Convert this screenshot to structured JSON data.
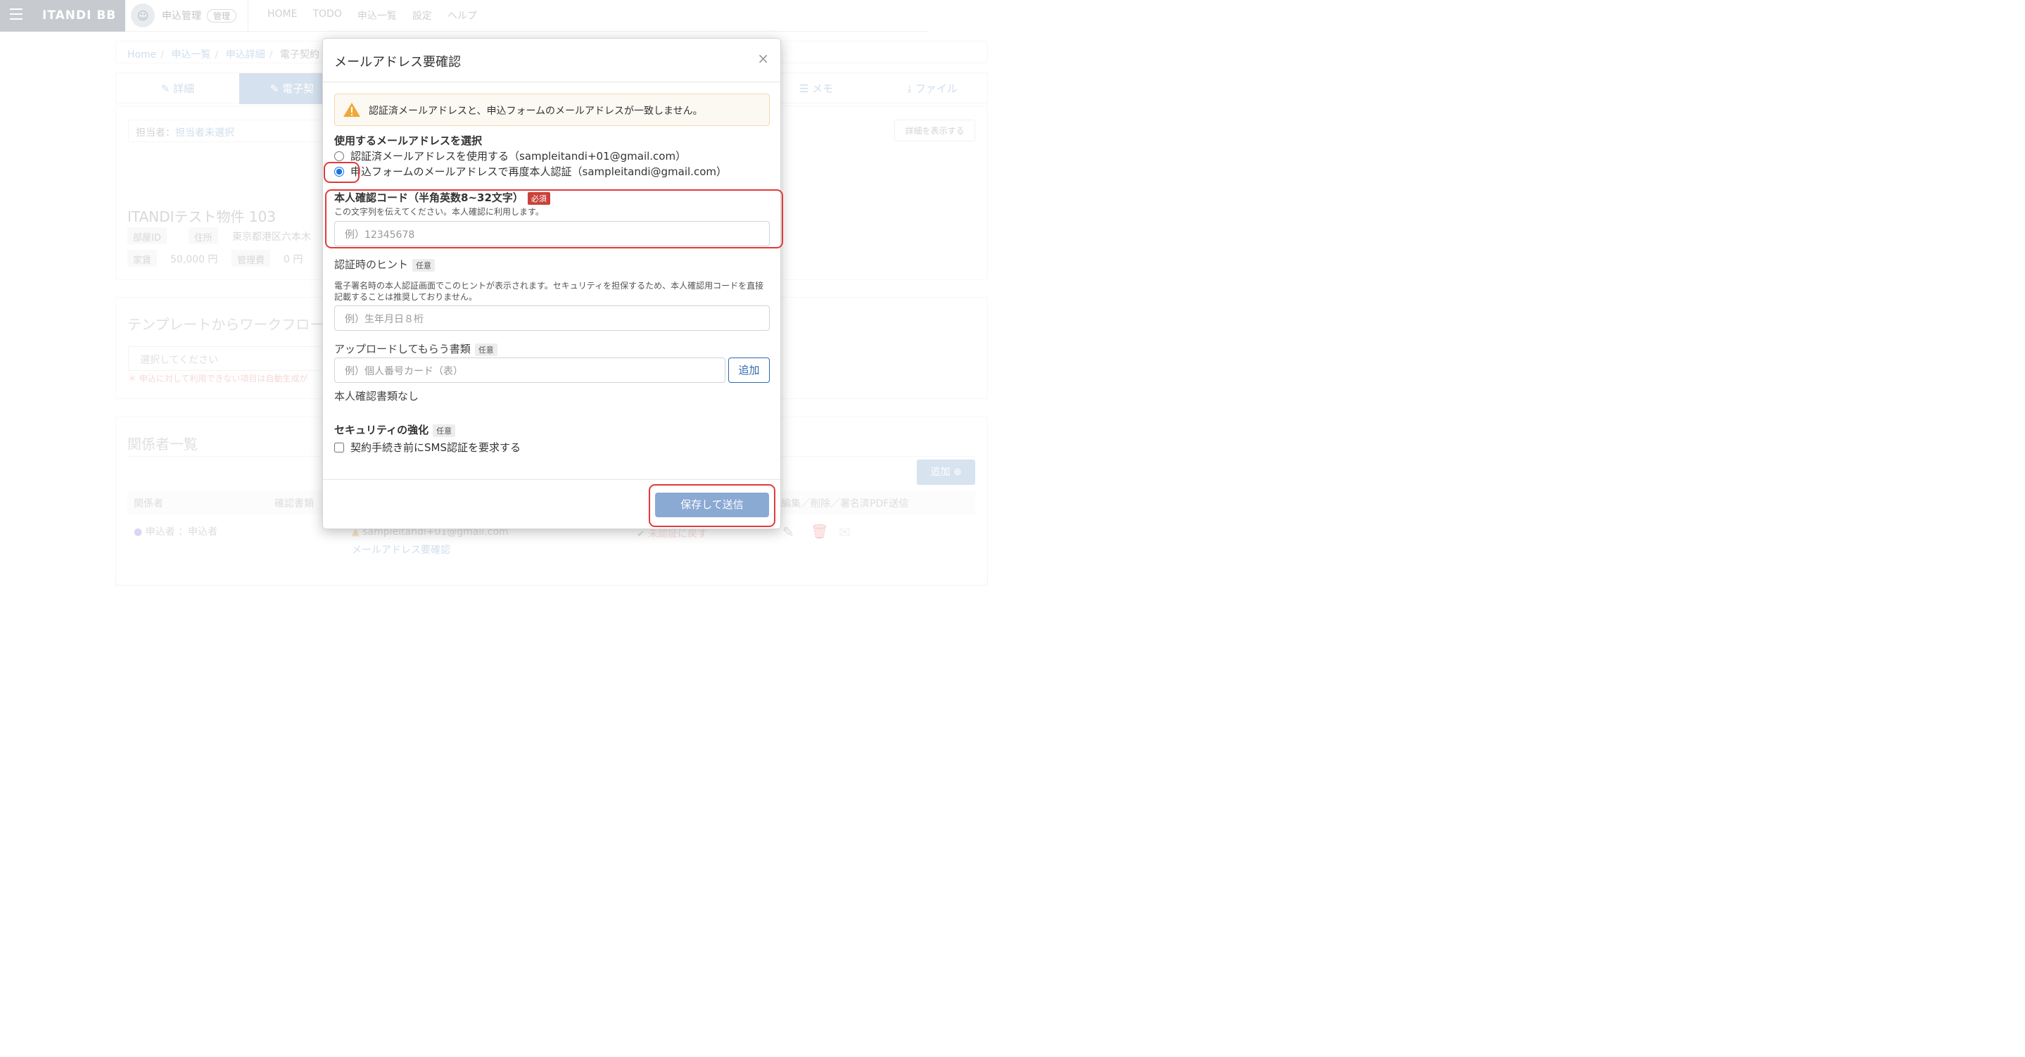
{
  "header": {
    "logo": "ITANDI BB",
    "app_name": "申込管理",
    "role_badge": "管理",
    "nav": [
      "HOME",
      "TODO",
      "申込一覧",
      "設定",
      "ヘルプ"
    ]
  },
  "breadcrumb": [
    "Home",
    "申込一覧",
    "申込詳細",
    "電子契約"
  ],
  "tabs": [
    "詳細",
    "電子契",
    "メモ",
    "ファイル"
  ],
  "assignee": {
    "label": "担当者：",
    "value": "担当者未選択"
  },
  "detail_button": "詳細を表示する",
  "property": {
    "title": "ITANDIテスト物件 103",
    "room_id_label": "部屋ID",
    "address_label": "住所",
    "address_value": "東京都港区六本木",
    "rent_label": "家賃",
    "rent_value": "50,000 円",
    "fee_label": "管理費",
    "fee_value": "0 円"
  },
  "template_section": {
    "title": "テンプレートからワークフロー",
    "select_placeholder": "選択してください",
    "note": "＊ 申込に対して利用できない項目は自動生成が"
  },
  "parties_section": {
    "title": "関係者一覧",
    "add_button": "追加",
    "columns": [
      "関係者",
      "確認書類",
      "編集／削除／署名済PDF送信"
    ],
    "row": {
      "party": "申込者 ：申込者",
      "email": "sampleitandi+01@gmail.com",
      "email_link": "メールアドレス要確認",
      "status": "未認証に戻す"
    }
  },
  "modal": {
    "title": "メールアドレス要確認",
    "close": "×",
    "alert": "認証済メールアドレスと、申込フォームのメールアドレスが一致しません。",
    "email_select_label": "使用するメールアドレスを選択",
    "option_verified": "認証済メールアドレスを使用する（sampleitandi+01@gmail.com）",
    "option_form": "申込フォームのメールアドレスで再度本人認証（sampleitandi@gmail.com）",
    "selected_option": "option_form",
    "code_label": "本人確認コード（半角英数8~32文字）",
    "required_badge": "必須",
    "code_help": "この文字列を伝えてください。本人確認に利用します。",
    "code_placeholder": "例）12345678",
    "hint_label": "認証時のヒント",
    "optional_badge": "任意",
    "hint_help": "電子署名時の本人認証画面でこのヒントが表示されます。セキュリティを担保するため、本人確認用コードを直接記載することは推奨しておりません。",
    "hint_placeholder": "例）生年月日８桁",
    "docs_label": "アップロードしてもらう書類",
    "docs_placeholder": "例）個人番号カード（表）",
    "docs_add_button": "追加",
    "no_docs_text": "本人確認書類なし",
    "security_label": "セキュリティの強化",
    "sms_checkbox": "契約手続き前にSMS認証を要求する",
    "sms_checked": false,
    "submit_button": "保存して送信"
  },
  "colors": {
    "primary_button": "#8aa9d3",
    "annotation": "#e03a3a",
    "required_badge": "#c9413a",
    "outline_button": "#2e6ab1"
  }
}
